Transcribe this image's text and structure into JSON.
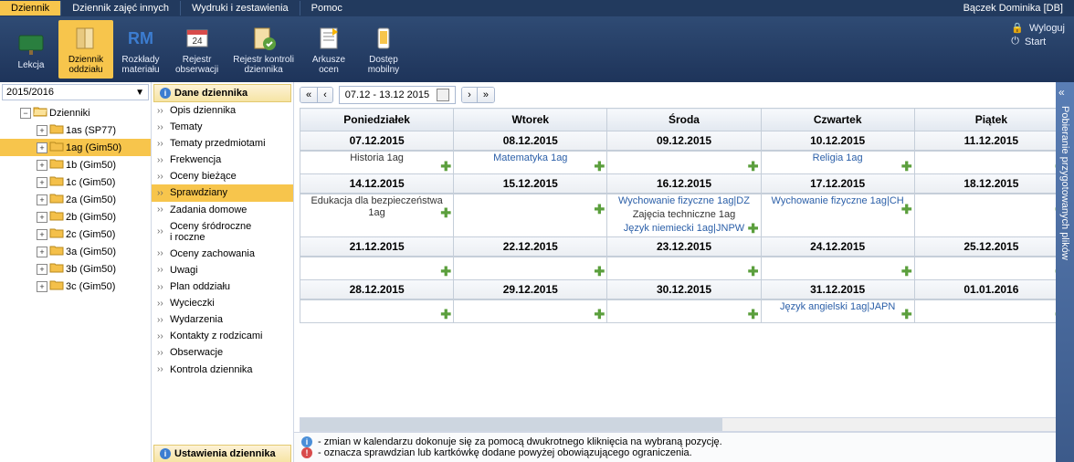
{
  "top_tabs": [
    {
      "label": "Dziennik",
      "active": true
    },
    {
      "label": "Dziennik zajęć innych",
      "active": false
    },
    {
      "label": "Wydruki i zestawienia",
      "active": false
    },
    {
      "label": "Pomoc",
      "active": false
    }
  ],
  "user_label": "Bączek Dominika [DB]",
  "ribbon": [
    {
      "label": "Lekcja",
      "active": false,
      "icon": "board"
    },
    {
      "label": "Dziennik\noddziału",
      "active": true,
      "icon": "book"
    },
    {
      "label": "Rozkłady\nmateriału",
      "active": false,
      "icon": "rm"
    },
    {
      "label": "Rejestr\nobserwacji",
      "active": false,
      "icon": "calendar"
    },
    {
      "label": "Rejestr kontroli\ndziennika",
      "active": false,
      "icon": "bookcheck"
    },
    {
      "label": "Arkusze\nocen",
      "active": false,
      "icon": "sheet"
    },
    {
      "label": "Dostęp\nmobilny",
      "active": false,
      "icon": "mobile"
    }
  ],
  "right_links": {
    "logout": "Wyloguj",
    "start": "Start"
  },
  "year": "2015/2016",
  "tree_root": "Dzienniki",
  "tree": [
    {
      "label": "1as (SP77)",
      "active": false
    },
    {
      "label": "1ag (Gim50)",
      "active": true
    },
    {
      "label": "1b (Gim50)",
      "active": false
    },
    {
      "label": "1c (Gim50)",
      "active": false
    },
    {
      "label": "2a (Gim50)",
      "active": false
    },
    {
      "label": "2b (Gim50)",
      "active": false
    },
    {
      "label": "2c (Gim50)",
      "active": false
    },
    {
      "label": "3a (Gim50)",
      "active": false
    },
    {
      "label": "3b (Gim50)",
      "active": false
    },
    {
      "label": "3c (Gim50)",
      "active": false
    }
  ],
  "section_title": "Dane dziennika",
  "nav": [
    {
      "label": "Opis dziennika",
      "active": false
    },
    {
      "label": "Tematy",
      "active": false
    },
    {
      "label": "Tematy przedmiotami",
      "active": false
    },
    {
      "label": "Frekwencja",
      "active": false
    },
    {
      "label": "Oceny bieżące",
      "active": false
    },
    {
      "label": "Sprawdziany",
      "active": true
    },
    {
      "label": "Zadania domowe",
      "active": false
    },
    {
      "label": "Oceny śródroczne\ni roczne",
      "active": false
    },
    {
      "label": "Oceny zachowania",
      "active": false
    },
    {
      "label": "Uwagi",
      "active": false
    },
    {
      "label": "Plan oddziału",
      "active": false
    },
    {
      "label": "Wycieczki",
      "active": false
    },
    {
      "label": "Wydarzenia",
      "active": false
    },
    {
      "label": "Kontakty z rodzicami",
      "active": false
    },
    {
      "label": "Obserwacje",
      "active": false
    },
    {
      "label": "Kontrola dziennika",
      "active": false
    }
  ],
  "section2_title": "Ustawienia dziennika",
  "date_range": "07.12 - 13.12 2015",
  "days": [
    "Poniedziałek",
    "Wtorek",
    "Środa",
    "Czwartek",
    "Piątek"
  ],
  "weeks": [
    {
      "dates": [
        "07.12.2015",
        "08.12.2015",
        "09.12.2015",
        "10.12.2015",
        "11.12.2015"
      ],
      "cells": [
        [
          {
            "text": "Historia 1ag",
            "link": false
          }
        ],
        [
          {
            "text": "Matematyka 1ag",
            "link": true
          }
        ],
        [],
        [
          {
            "text": "Religia 1ag",
            "link": true
          }
        ],
        []
      ]
    },
    {
      "dates": [
        "14.12.2015",
        "15.12.2015",
        "16.12.2015",
        "17.12.2015",
        "18.12.2015"
      ],
      "cells": [
        [
          {
            "text": "Edukacja dla bezpieczeństwa 1ag",
            "link": false
          }
        ],
        [],
        [
          {
            "text": "Wychowanie fizyczne 1ag|DZ",
            "link": true
          },
          {
            "text": "Zajęcia techniczne 1ag",
            "link": false
          },
          {
            "text": "Język niemiecki 1ag|JNPW",
            "link": true
          }
        ],
        [
          {
            "text": "Wychowanie fizyczne 1ag|CH",
            "link": true
          }
        ],
        []
      ]
    },
    {
      "dates": [
        "21.12.2015",
        "22.12.2015",
        "23.12.2015",
        "24.12.2015",
        "25.12.2015"
      ],
      "cells": [
        [],
        [],
        [],
        [],
        []
      ]
    },
    {
      "dates": [
        "28.12.2015",
        "29.12.2015",
        "30.12.2015",
        "31.12.2015",
        "01.01.2016"
      ],
      "cells": [
        [],
        [],
        [],
        [
          {
            "text": "Język angielski 1ag|JAPN",
            "link": true
          }
        ],
        []
      ]
    }
  ],
  "footer": {
    "info": "- zmian w kalendarzu dokonuje się za pomocą dwukrotnego kliknięcia na wybraną pozycję.",
    "warn": "- oznacza sprawdzian lub kartkówkę dodane powyżej obowiązującego ograniczenia."
  },
  "right_panel": "Pobieranie przygotowanych plików"
}
